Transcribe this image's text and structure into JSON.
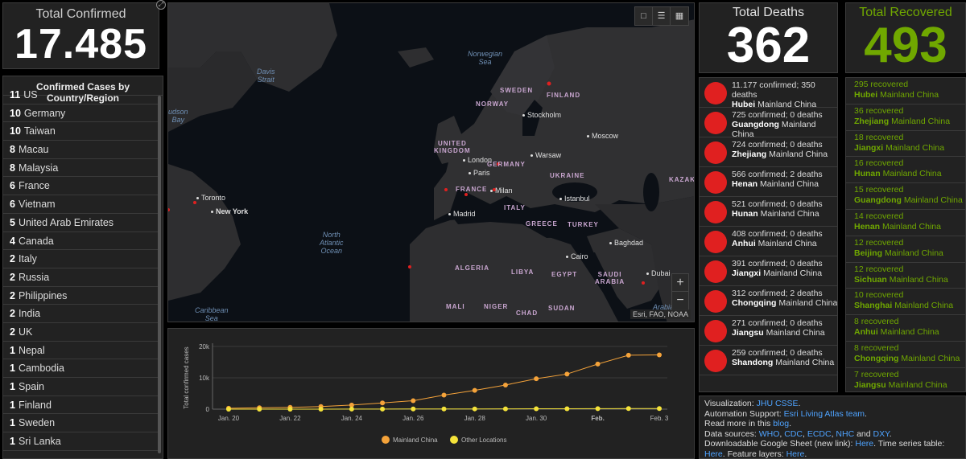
{
  "confirmed": {
    "label": "Total Confirmed",
    "value": "17.485"
  },
  "country_panel": {
    "header": "Confirmed Cases by Country/Region",
    "items": [
      {
        "count": "11",
        "name": "US"
      },
      {
        "count": "10",
        "name": "Germany"
      },
      {
        "count": "10",
        "name": "Taiwan"
      },
      {
        "count": "8",
        "name": "Macau"
      },
      {
        "count": "8",
        "name": "Malaysia"
      },
      {
        "count": "6",
        "name": "France"
      },
      {
        "count": "6",
        "name": "Vietnam"
      },
      {
        "count": "5",
        "name": "United Arab Emirates"
      },
      {
        "count": "4",
        "name": "Canada"
      },
      {
        "count": "2",
        "name": "Italy"
      },
      {
        "count": "2",
        "name": "Russia"
      },
      {
        "count": "2",
        "name": "Philippines"
      },
      {
        "count": "2",
        "name": "India"
      },
      {
        "count": "2",
        "name": "UK"
      },
      {
        "count": "1",
        "name": "Nepal"
      },
      {
        "count": "1",
        "name": "Cambodia"
      },
      {
        "count": "1",
        "name": "Spain"
      },
      {
        "count": "1",
        "name": "Finland"
      },
      {
        "count": "1",
        "name": "Sweden"
      },
      {
        "count": "1",
        "name": "Sri Lanka"
      }
    ]
  },
  "map": {
    "attribution": "Esri, FAO, NOAA",
    "toolbar_icons": [
      "bookmark-icon",
      "legend-list-icon",
      "qr-code-icon"
    ],
    "zoom_in": "+",
    "zoom_out": "−",
    "labels": {
      "davis_strait": "Davis\nStrait",
      "hudson_bay": "udson\nBay",
      "norwegian_sea": "Norwegian\nSea",
      "north_atlantic": "North\nAtlantic\nOcean",
      "caribbean": "Caribbean\nSea",
      "arabian": "Arabian",
      "sweden": "SWEDEN",
      "norway": "NORWAY",
      "finland": "FINLAND",
      "uk": "UNITED\nKINGDOM",
      "germany": "GERMANY",
      "france": "FRANCE",
      "ukraine": "UKRAINE",
      "italy": "ITALY",
      "greece": "GREECE",
      "turkey": "TURKEY",
      "kazak": "KAZAK",
      "algeria": "ALGERIA",
      "libya": "LIBYA",
      "egypt": "EGYPT",
      "saudi": "SAUDI\nARABIA",
      "mali": "MALI",
      "niger": "NIGER",
      "chad": "CHAD",
      "sudan": "SUDAN",
      "stockholm": "Stockholm",
      "moscow": "Moscow",
      "london": "London",
      "warsaw": "Warsaw",
      "paris": "Paris",
      "milan": "Milan",
      "istanbul": "Istanbul",
      "madrid": "Madrid",
      "toronto": "Toronto",
      "new_york": "New York",
      "baghdad": "Baghdad",
      "cairo": "Cairo",
      "dubai": "Dubai"
    }
  },
  "deaths": {
    "label": "Total Deaths",
    "value": "362",
    "items": [
      {
        "stats": "11.177 confirmed; 350 deaths",
        "region": "Hubei",
        "country": "Mainland China"
      },
      {
        "stats": "725 confirmed; 0 deaths",
        "region": "Guangdong",
        "country": "Mainland China"
      },
      {
        "stats": "724 confirmed; 0 deaths",
        "region": "Zhejiang",
        "country": "Mainland China"
      },
      {
        "stats": "566 confirmed; 2 deaths",
        "region": "Henan",
        "country": "Mainland China"
      },
      {
        "stats": "521 confirmed; 0 deaths",
        "region": "Hunan",
        "country": "Mainland China"
      },
      {
        "stats": "408 confirmed; 0 deaths",
        "region": "Anhui",
        "country": "Mainland China"
      },
      {
        "stats": "391 confirmed; 0 deaths",
        "region": "Jiangxi",
        "country": "Mainland China"
      },
      {
        "stats": "312 confirmed; 2 deaths",
        "region": "Chongqing",
        "country": "Mainland China"
      },
      {
        "stats": "271 confirmed; 0 deaths",
        "region": "Jiangsu",
        "country": "Mainland China"
      },
      {
        "stats": "259 confirmed; 0 deaths",
        "region": "Shandong",
        "country": "Mainland China"
      }
    ]
  },
  "recovered": {
    "label": "Total Recovered",
    "value": "493",
    "items": [
      {
        "stats": "295 recovered",
        "region": "Hubei",
        "country": "Mainland China"
      },
      {
        "stats": "36 recovered",
        "region": "Zhejiang",
        "country": "Mainland China"
      },
      {
        "stats": "18 recovered",
        "region": "Jiangxi",
        "country": "Mainland China"
      },
      {
        "stats": "16 recovered",
        "region": "Hunan",
        "country": "Mainland China"
      },
      {
        "stats": "15 recovered",
        "region": "Guangdong",
        "country": "Mainland China"
      },
      {
        "stats": "14 recovered",
        "region": "Henan",
        "country": "Mainland China"
      },
      {
        "stats": "12 recovered",
        "region": "Beijing",
        "country": "Mainland China"
      },
      {
        "stats": "12 recovered",
        "region": "Sichuan",
        "country": "Mainland China"
      },
      {
        "stats": "10 recovered",
        "region": "Shanghai",
        "country": "Mainland China"
      },
      {
        "stats": "8 recovered",
        "region": "Anhui",
        "country": "Mainland China"
      },
      {
        "stats": "8 recovered",
        "region": "Chongqing",
        "country": "Mainland China"
      },
      {
        "stats": "7 recovered",
        "region": "Jiangsu",
        "country": "Mainland China"
      }
    ]
  },
  "info": {
    "vis_label": "Visualization:",
    "vis_link": "JHU CSSE",
    "auto_label": "Automation Support:",
    "auto_link": "Esri Living Atlas team",
    "read_prefix": "Read more in this",
    "read_link": "blog",
    "sources_label": "Data sources:",
    "sources": [
      "WHO",
      "CDC",
      "ECDC",
      "NHC",
      "DXY"
    ],
    "and": "and",
    "sheet_label": "Downloadable Google Sheet (new link):",
    "sheet_link": "Here",
    "series_label": "Time series table:",
    "series_link": "Here",
    "feature_label": "Feature layers:",
    "feature_link": "Here"
  },
  "colors": {
    "mainland": "#f5a33a",
    "other": "#f5e33a",
    "death_dot": "#e02020",
    "recovered": "#70a800"
  },
  "chart_data": {
    "type": "line",
    "ylabel": "Total confirmed cases",
    "xlabel": "",
    "title": "",
    "x": [
      "Jan. 20",
      "Jan. 21",
      "Jan. 22",
      "Jan. 23",
      "Jan. 24",
      "Jan. 25",
      "Jan. 26",
      "Jan. 27",
      "Jan. 28",
      "Jan. 29",
      "Jan. 30",
      "Jan. 31",
      "Feb. 1",
      "Feb. 2",
      "Feb. 3"
    ],
    "x_tick_labels": [
      "Jan. 20",
      "Jan. 22",
      "Jan. 24",
      "Jan. 26",
      "Jan. 28",
      "Jan. 30",
      "Feb.",
      "Feb. 3"
    ],
    "y_ticks": [
      "0",
      "10k",
      "20k"
    ],
    "ylim": [
      0,
      20000
    ],
    "series": [
      {
        "name": "Mainland China",
        "values": [
          280,
          440,
          570,
          830,
          1300,
          2000,
          2700,
          4500,
          6000,
          7700,
          9700,
          11200,
          14400,
          17200,
          17300
        ]
      },
      {
        "name": "Other Locations",
        "values": [
          5,
          8,
          10,
          15,
          25,
          40,
          60,
          70,
          80,
          100,
          120,
          140,
          150,
          180,
          190
        ]
      }
    ],
    "legend_position": "bottom-center",
    "grid": true
  }
}
